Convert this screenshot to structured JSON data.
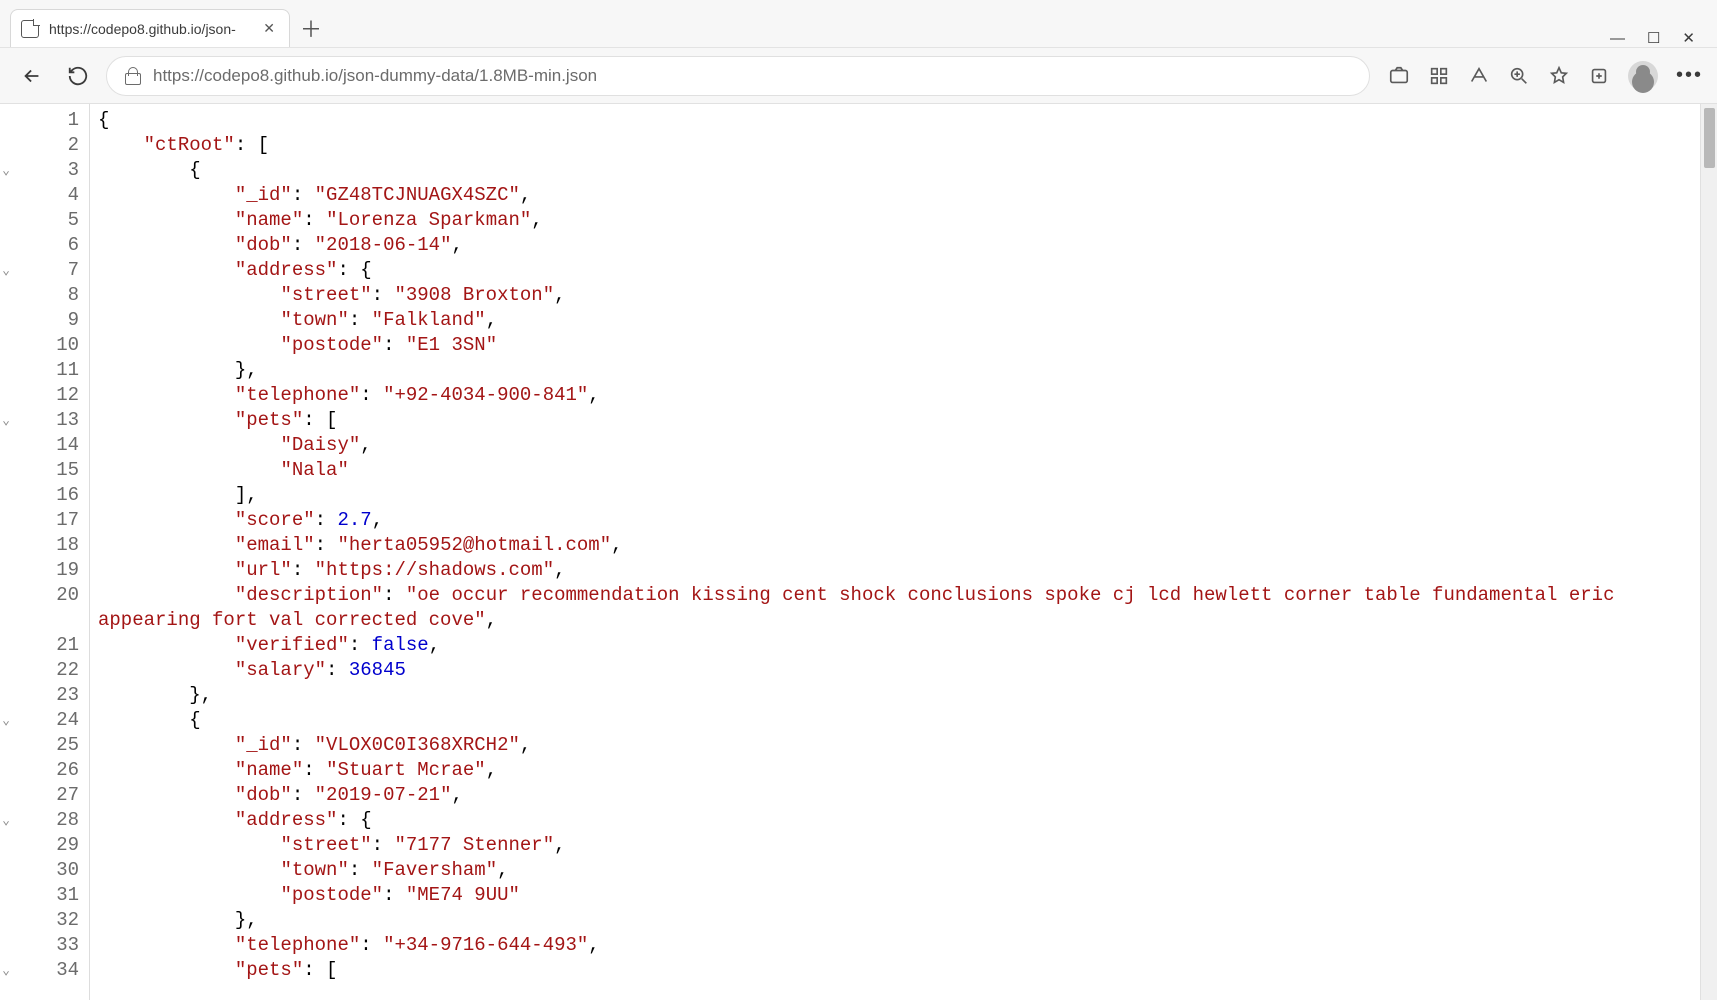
{
  "tab": {
    "title": "https://codepo8.github.io/json-"
  },
  "toolbar": {
    "url": "https://codepo8.github.io/json-dummy-data/1.8MB-min.json"
  },
  "fold_markers": [
    3,
    7,
    13,
    24,
    28,
    34
  ],
  "code_lines": [
    {
      "n": 1,
      "tokens": [
        [
          "p",
          "{"
        ]
      ]
    },
    {
      "n": 2,
      "tokens": [
        [
          "p",
          "    "
        ],
        [
          "k",
          "\"ctRoot\""
        ],
        [
          "p",
          ": ["
        ]
      ]
    },
    {
      "n": 3,
      "tokens": [
        [
          "p",
          "        {"
        ]
      ]
    },
    {
      "n": 4,
      "tokens": [
        [
          "p",
          "            "
        ],
        [
          "k",
          "\"_id\""
        ],
        [
          "p",
          ": "
        ],
        [
          "s",
          "\"GZ48TCJNUAGX4SZC\""
        ],
        [
          "p",
          ","
        ]
      ]
    },
    {
      "n": 5,
      "tokens": [
        [
          "p",
          "            "
        ],
        [
          "k",
          "\"name\""
        ],
        [
          "p",
          ": "
        ],
        [
          "s",
          "\"Lorenza Sparkman\""
        ],
        [
          "p",
          ","
        ]
      ]
    },
    {
      "n": 6,
      "tokens": [
        [
          "p",
          "            "
        ],
        [
          "k",
          "\"dob\""
        ],
        [
          "p",
          ": "
        ],
        [
          "s",
          "\"2018-06-14\""
        ],
        [
          "p",
          ","
        ]
      ]
    },
    {
      "n": 7,
      "tokens": [
        [
          "p",
          "            "
        ],
        [
          "k",
          "\"address\""
        ],
        [
          "p",
          ": {"
        ]
      ]
    },
    {
      "n": 8,
      "tokens": [
        [
          "p",
          "                "
        ],
        [
          "k",
          "\"street\""
        ],
        [
          "p",
          ": "
        ],
        [
          "s",
          "\"3908 Broxton\""
        ],
        [
          "p",
          ","
        ]
      ]
    },
    {
      "n": 9,
      "tokens": [
        [
          "p",
          "                "
        ],
        [
          "k",
          "\"town\""
        ],
        [
          "p",
          ": "
        ],
        [
          "s",
          "\"Falkland\""
        ],
        [
          "p",
          ","
        ]
      ]
    },
    {
      "n": 10,
      "tokens": [
        [
          "p",
          "                "
        ],
        [
          "k",
          "\"postode\""
        ],
        [
          "p",
          ": "
        ],
        [
          "s",
          "\"E1 3SN\""
        ]
      ]
    },
    {
      "n": 11,
      "tokens": [
        [
          "p",
          "            },"
        ]
      ]
    },
    {
      "n": 12,
      "tokens": [
        [
          "p",
          "            "
        ],
        [
          "k",
          "\"telephone\""
        ],
        [
          "p",
          ": "
        ],
        [
          "s",
          "\"+92-4034-900-841\""
        ],
        [
          "p",
          ","
        ]
      ]
    },
    {
      "n": 13,
      "tokens": [
        [
          "p",
          "            "
        ],
        [
          "k",
          "\"pets\""
        ],
        [
          "p",
          ": ["
        ]
      ]
    },
    {
      "n": 14,
      "tokens": [
        [
          "p",
          "                "
        ],
        [
          "s",
          "\"Daisy\""
        ],
        [
          "p",
          ","
        ]
      ]
    },
    {
      "n": 15,
      "tokens": [
        [
          "p",
          "                "
        ],
        [
          "s",
          "\"Nala\""
        ]
      ]
    },
    {
      "n": 16,
      "tokens": [
        [
          "p",
          "            ],"
        ]
      ]
    },
    {
      "n": 17,
      "tokens": [
        [
          "p",
          "            "
        ],
        [
          "k",
          "\"score\""
        ],
        [
          "p",
          ": "
        ],
        [
          "n",
          "2.7"
        ],
        [
          "p",
          ","
        ]
      ]
    },
    {
      "n": 18,
      "tokens": [
        [
          "p",
          "            "
        ],
        [
          "k",
          "\"email\""
        ],
        [
          "p",
          ": "
        ],
        [
          "s",
          "\"herta05952@hotmail.com\""
        ],
        [
          "p",
          ","
        ]
      ]
    },
    {
      "n": 19,
      "tokens": [
        [
          "p",
          "            "
        ],
        [
          "k",
          "\"url\""
        ],
        [
          "p",
          ": "
        ],
        [
          "s",
          "\"https://shadows.com\""
        ],
        [
          "p",
          ","
        ]
      ]
    },
    {
      "n": 20,
      "tokens": [
        [
          "p",
          "            "
        ],
        [
          "k",
          "\"description\""
        ],
        [
          "p",
          ": "
        ],
        [
          "s",
          "\"oe occur recommendation kissing cent shock conclusions spoke cj lcd hewlett corner table fundamental eric appearing fort val corrected cove\""
        ],
        [
          "p",
          ","
        ]
      ]
    },
    {
      "n": 21,
      "tokens": [
        [
          "p",
          "            "
        ],
        [
          "k",
          "\"verified\""
        ],
        [
          "p",
          ": "
        ],
        [
          "b",
          "false"
        ],
        [
          "p",
          ","
        ]
      ]
    },
    {
      "n": 22,
      "tokens": [
        [
          "p",
          "            "
        ],
        [
          "k",
          "\"salary\""
        ],
        [
          "p",
          ": "
        ],
        [
          "n",
          "36845"
        ]
      ]
    },
    {
      "n": 23,
      "tokens": [
        [
          "p",
          "        },"
        ]
      ]
    },
    {
      "n": 24,
      "tokens": [
        [
          "p",
          "        {"
        ]
      ]
    },
    {
      "n": 25,
      "tokens": [
        [
          "p",
          "            "
        ],
        [
          "k",
          "\"_id\""
        ],
        [
          "p",
          ": "
        ],
        [
          "s",
          "\"VLOX0C0I368XRCH2\""
        ],
        [
          "p",
          ","
        ]
      ]
    },
    {
      "n": 26,
      "tokens": [
        [
          "p",
          "            "
        ],
        [
          "k",
          "\"name\""
        ],
        [
          "p",
          ": "
        ],
        [
          "s",
          "\"Stuart Mcrae\""
        ],
        [
          "p",
          ","
        ]
      ]
    },
    {
      "n": 27,
      "tokens": [
        [
          "p",
          "            "
        ],
        [
          "k",
          "\"dob\""
        ],
        [
          "p",
          ": "
        ],
        [
          "s",
          "\"2019-07-21\""
        ],
        [
          "p",
          ","
        ]
      ]
    },
    {
      "n": 28,
      "tokens": [
        [
          "p",
          "            "
        ],
        [
          "k",
          "\"address\""
        ],
        [
          "p",
          ": {"
        ]
      ]
    },
    {
      "n": 29,
      "tokens": [
        [
          "p",
          "                "
        ],
        [
          "k",
          "\"street\""
        ],
        [
          "p",
          ": "
        ],
        [
          "s",
          "\"7177 Stenner\""
        ],
        [
          "p",
          ","
        ]
      ]
    },
    {
      "n": 30,
      "tokens": [
        [
          "p",
          "                "
        ],
        [
          "k",
          "\"town\""
        ],
        [
          "p",
          ": "
        ],
        [
          "s",
          "\"Faversham\""
        ],
        [
          "p",
          ","
        ]
      ]
    },
    {
      "n": 31,
      "tokens": [
        [
          "p",
          "                "
        ],
        [
          "k",
          "\"postode\""
        ],
        [
          "p",
          ": "
        ],
        [
          "s",
          "\"ME74 9UU\""
        ]
      ]
    },
    {
      "n": 32,
      "tokens": [
        [
          "p",
          "            },"
        ]
      ]
    },
    {
      "n": 33,
      "tokens": [
        [
          "p",
          "            "
        ],
        [
          "k",
          "\"telephone\""
        ],
        [
          "p",
          ": "
        ],
        [
          "s",
          "\"+34-9716-644-493\""
        ],
        [
          "p",
          ","
        ]
      ]
    },
    {
      "n": 34,
      "tokens": [
        [
          "p",
          "            "
        ],
        [
          "k",
          "\"pets\""
        ],
        [
          "p",
          ": ["
        ]
      ]
    }
  ]
}
